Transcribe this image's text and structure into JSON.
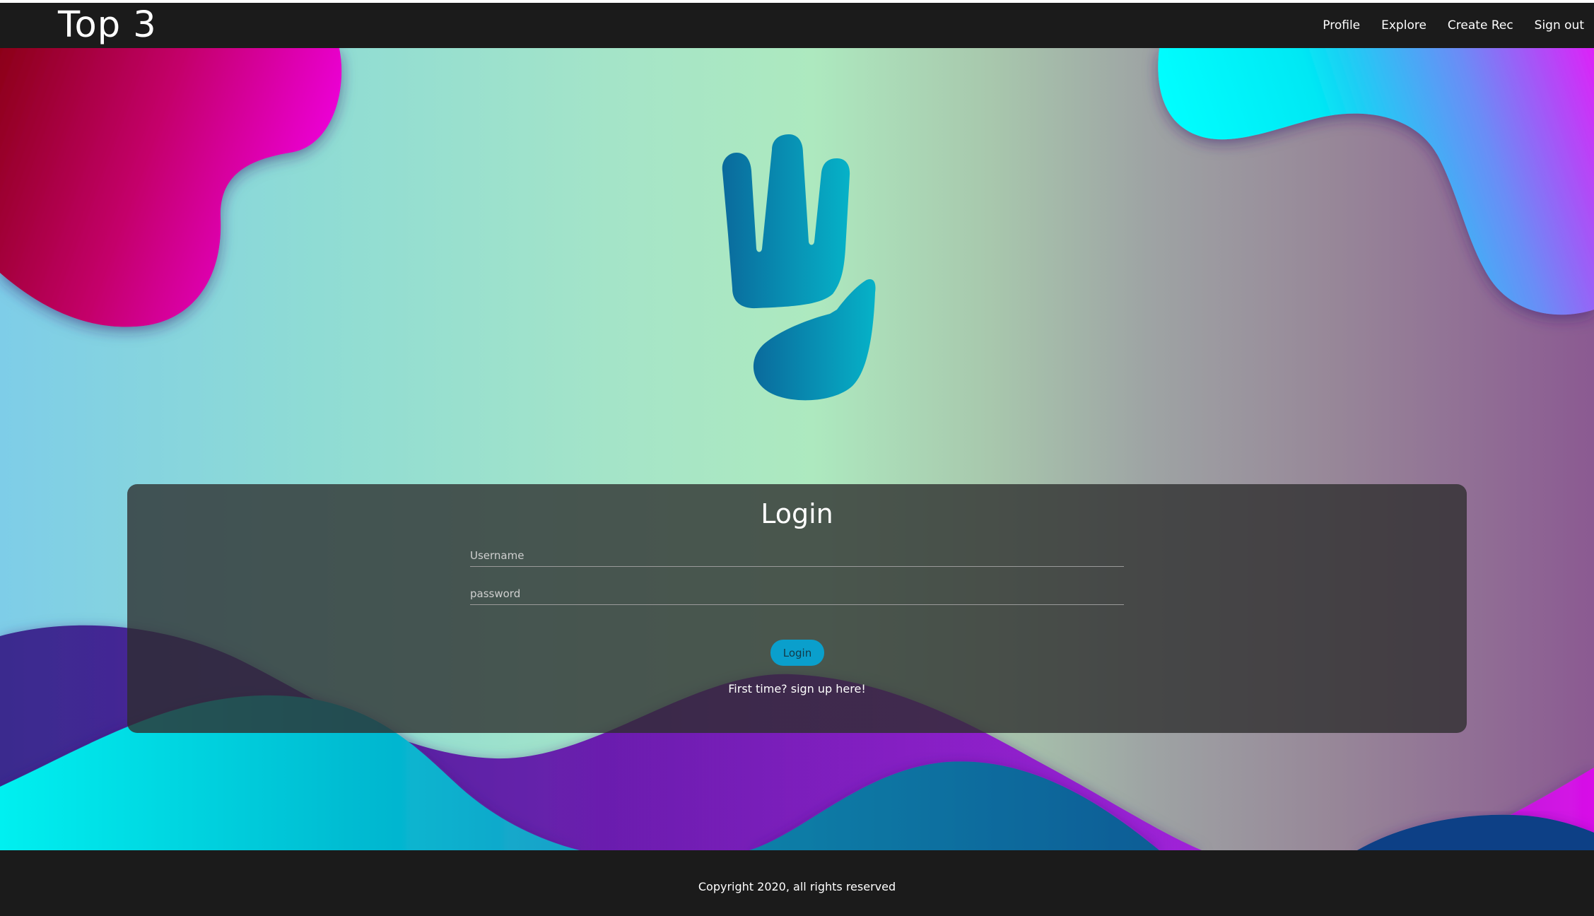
{
  "navbar": {
    "brand": "Top 3",
    "links": [
      "Profile",
      "Explore",
      "Create Rec",
      "Sign out"
    ]
  },
  "login": {
    "title": "Login",
    "username_placeholder": "Username",
    "password_placeholder": "password",
    "button_label": "Login",
    "signup_text": "First time? sign up here!"
  },
  "footer": {
    "copyright": "Copyright 2020, all rights reserved"
  },
  "colors": {
    "navbar_bg": "#1b1b1b",
    "button_bg": "#0a9fcc",
    "logo_blue": "#0a6a9c",
    "logo_cyan": "#06b2c8"
  },
  "icons": {
    "logo": "hand-logo-icon"
  }
}
